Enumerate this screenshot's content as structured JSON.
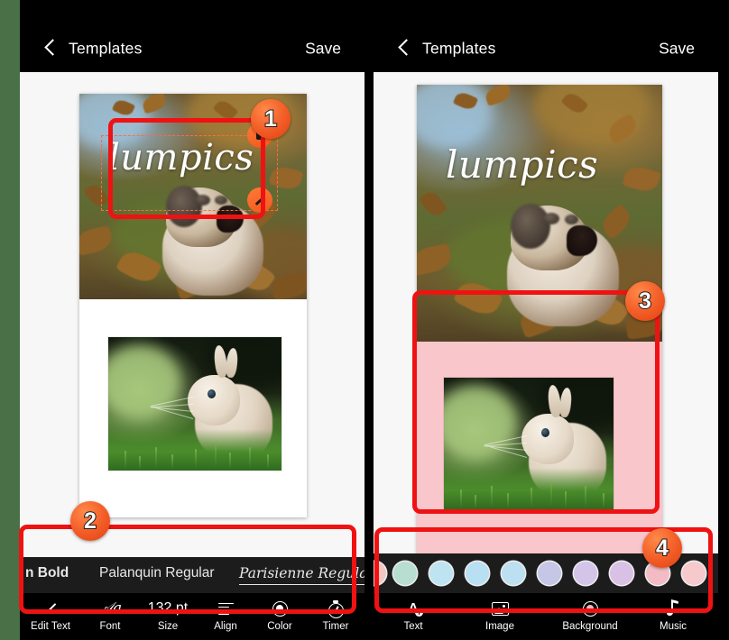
{
  "app": {
    "nav": {
      "back_icon": "chevron-left-icon",
      "title": "Templates",
      "save_label": "Save"
    }
  },
  "left_panel": {
    "nav": {
      "title": "Templates",
      "save_label": "Save"
    },
    "design": {
      "logo_text": "lumpics",
      "selection": {
        "delete_icon": "trash-icon",
        "edit_icon": "pencil-icon"
      }
    },
    "font_row": {
      "items": [
        {
          "label": "n Bold",
          "selected": false,
          "bold": true
        },
        {
          "label": "Palanquin Regular",
          "selected": false,
          "bold": false
        },
        {
          "label": "Parisienne Regular",
          "selected": true,
          "bold": false
        }
      ]
    },
    "tools": [
      {
        "icon": "pencil-icon",
        "label": "Edit Text",
        "value": ""
      },
      {
        "icon": "font-aa-icon",
        "label": "Font",
        "value": ""
      },
      {
        "icon": "size-value",
        "label": "Size",
        "value": "132 pt"
      },
      {
        "icon": "align-icon",
        "label": "Align",
        "value": ""
      },
      {
        "icon": "color-circle-icon",
        "label": "Color",
        "value": ""
      },
      {
        "icon": "timer-icon",
        "label": "Timer",
        "value": ""
      }
    ]
  },
  "right_panel": {
    "nav": {
      "title": "Templates",
      "save_label": "Save"
    },
    "design": {
      "logo_text": "lumpics",
      "background_color": "#f8c6cb"
    },
    "swatches": [
      {
        "name": "swatch-mint",
        "color": "#b7ded1",
        "dotted": false
      },
      {
        "name": "swatch-sky-dotted",
        "color": "#bfe4f1",
        "dotted": true
      },
      {
        "name": "swatch-light-blue",
        "color": "#b9dff2",
        "dotted": false
      },
      {
        "name": "swatch-blue-dotted",
        "color": "#bcdff1",
        "dotted": true
      },
      {
        "name": "swatch-periwinkle",
        "color": "#c6c7e6",
        "dotted": false
      },
      {
        "name": "swatch-lavender",
        "color": "#d3c4e8",
        "dotted": false
      },
      {
        "name": "swatch-violet-dotted",
        "color": "#d9c1e6",
        "dotted": true
      },
      {
        "name": "swatch-pink",
        "color": "#f3bcc4",
        "dotted": false
      },
      {
        "name": "swatch-rose",
        "color": "#f6c9cd",
        "dotted": false
      }
    ],
    "tools": [
      {
        "icon": "text-add-icon",
        "label": "Text"
      },
      {
        "icon": "image-icon",
        "label": "Image"
      },
      {
        "icon": "background-icon",
        "label": "Background"
      },
      {
        "icon": "music-note-icon",
        "label": "Music"
      }
    ]
  },
  "annotations": {
    "accent_color": "#f01212",
    "badges": [
      {
        "number": "1"
      },
      {
        "number": "2"
      },
      {
        "number": "3"
      },
      {
        "number": "4"
      }
    ]
  }
}
